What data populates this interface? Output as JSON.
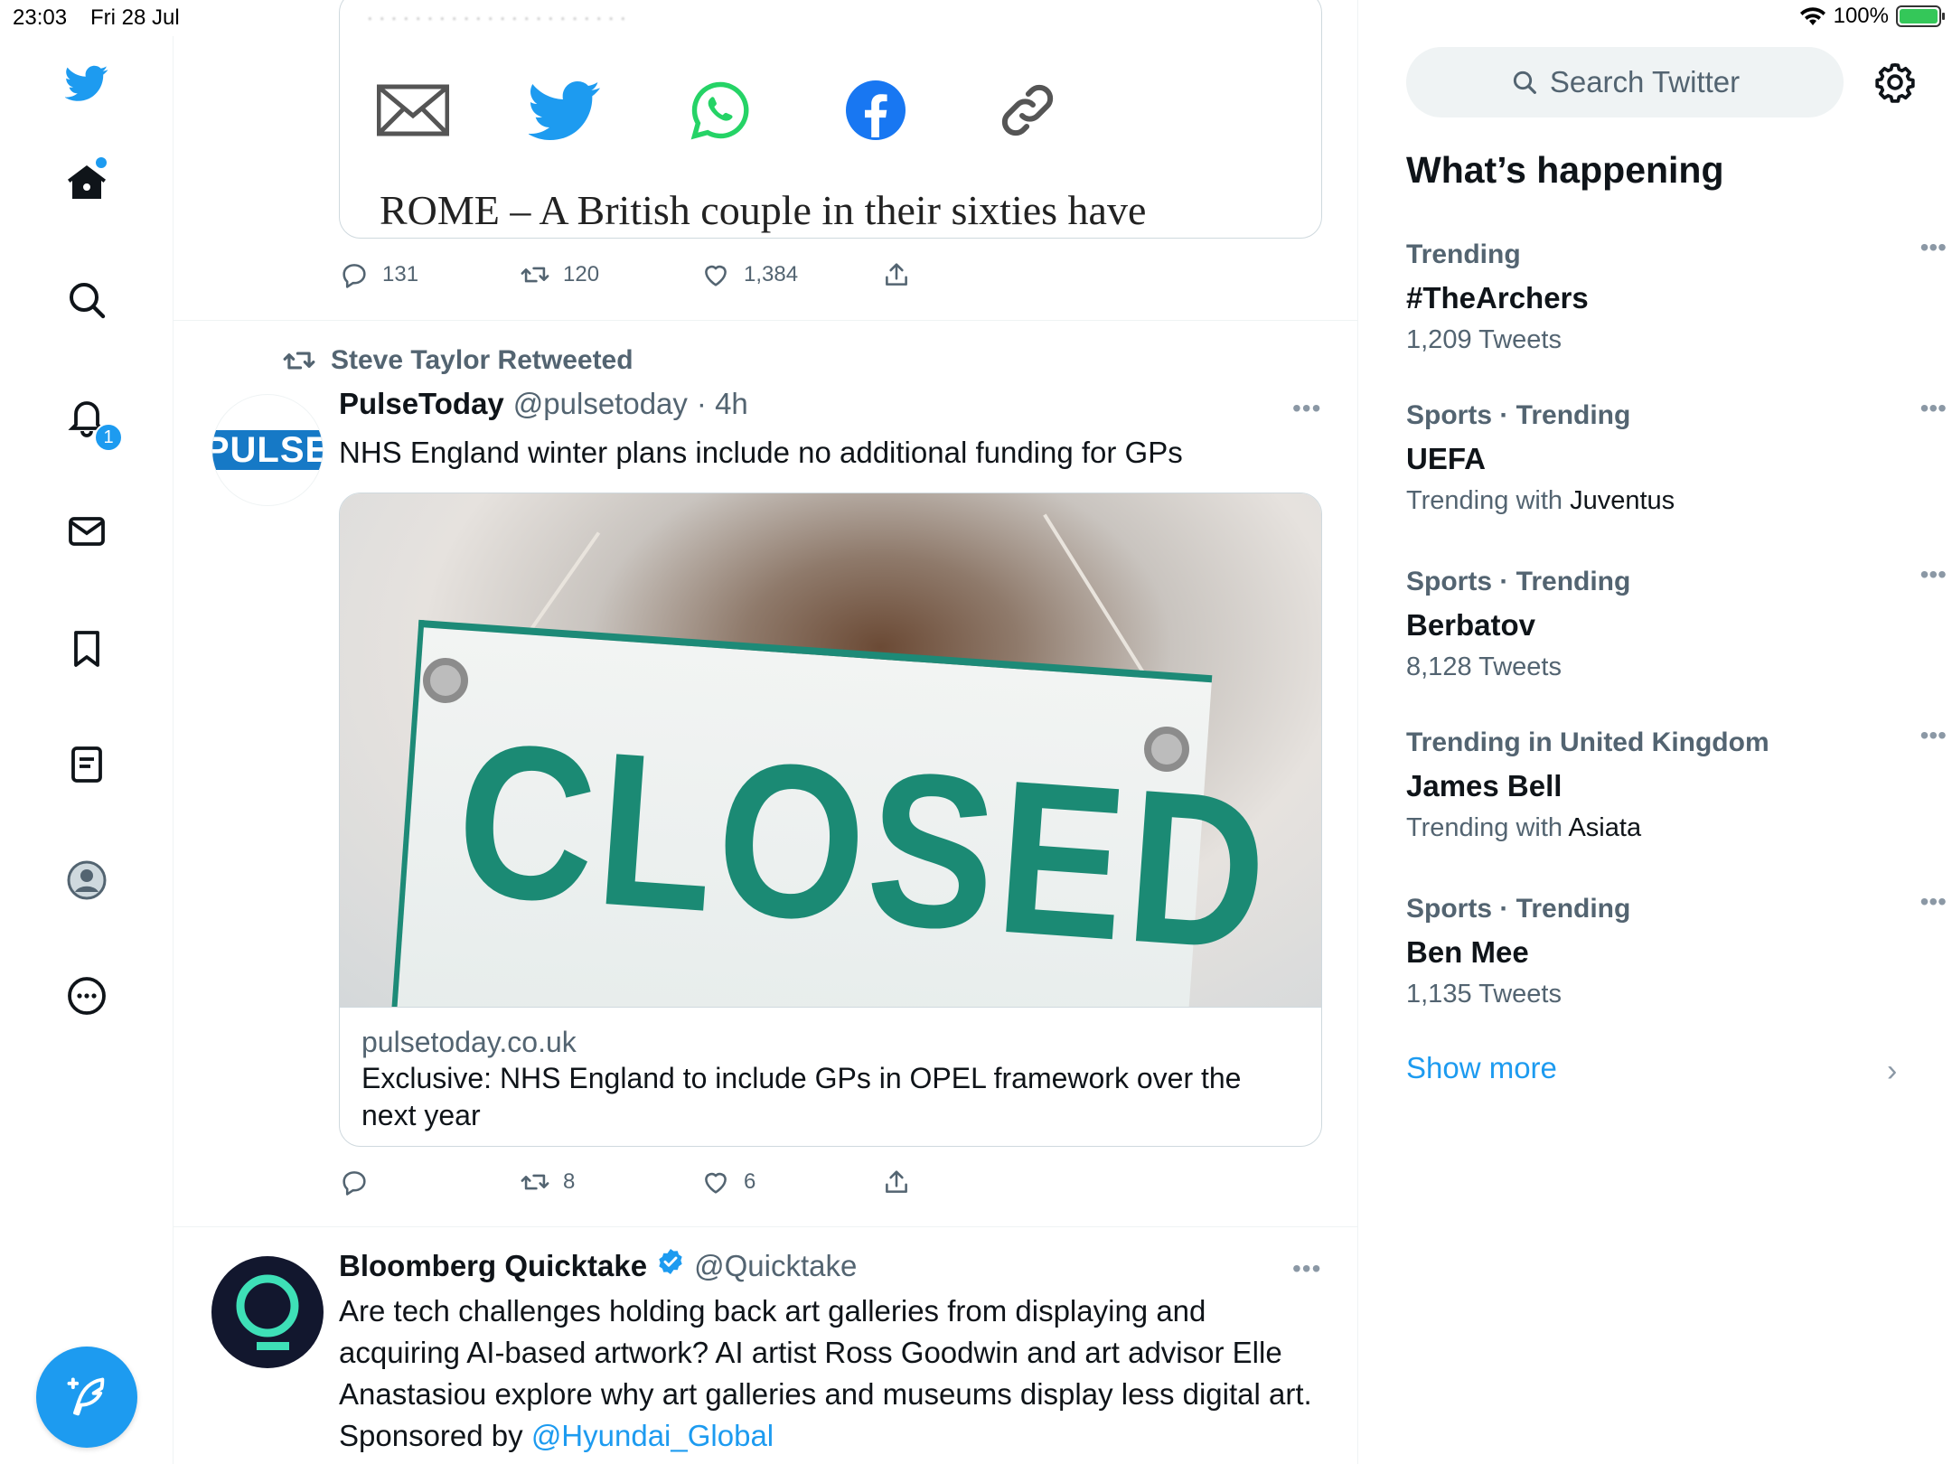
{
  "status_bar": {
    "time": "23:03",
    "date": "Fri 28 Jul",
    "battery": "100%",
    "handle_dots": "•••"
  },
  "nav": {
    "notification_count": "1",
    "icons": [
      "twitter-bird-icon",
      "home-icon",
      "search-icon",
      "bell-icon",
      "mail-icon",
      "bookmark-icon",
      "lists-icon",
      "profile-icon",
      "more-icon"
    ]
  },
  "tweet_top": {
    "article_snippet": "ROME – A British couple in their sixties have",
    "replies": "131",
    "retweets": "120",
    "likes": "1,384"
  },
  "tweet_pulse": {
    "retweeted_by": "Steve Taylor Retweeted",
    "avatar_text": "PULSE",
    "name": "PulseToday",
    "handle": "@pulsetoday",
    "time": "· 4h",
    "text": "NHS England winter plans include no additional funding for GPs",
    "photo_text": "CLOSED",
    "link_domain": "pulsetoday.co.uk",
    "link_title": "Exclusive: NHS England to include GPs in OPEL framework over the next year",
    "replies": "",
    "retweets": "8",
    "likes": "6"
  },
  "tweet_bloomberg": {
    "name": "Bloomberg Quicktake",
    "handle": "@Quicktake",
    "text": "Are tech challenges holding back art galleries from displaying and acquiring AI-based artwork? AI artist Ross Goodwin and art advisor Elle Anastasiou explore why art galleries and museums display less digital art. Sponsored by ",
    "mention": "@Hyundai_Global"
  },
  "sidebar": {
    "search_placeholder": "Search Twitter",
    "title": "What’s happening",
    "trends": [
      {
        "meta": "Trending",
        "topic": "#TheArchers",
        "sub": "1,209 Tweets",
        "sub_bold": ""
      },
      {
        "meta": "Sports · Trending",
        "topic": "UEFA",
        "sub": "Trending with ",
        "sub_bold": "Juventus"
      },
      {
        "meta": "Sports · Trending",
        "topic": "Berbatov",
        "sub": "8,128 Tweets",
        "sub_bold": ""
      },
      {
        "meta": "Trending in United Kingdom",
        "topic": "James Bell",
        "sub": "Trending with ",
        "sub_bold": "Asiata"
      },
      {
        "meta": "Sports · Trending",
        "topic": "Ben Mee",
        "sub": "1,135 Tweets",
        "sub_bold": ""
      }
    ],
    "show_more": "Show more"
  },
  "colors": {
    "accent": "#1d9bf0",
    "text_primary": "#0f1419",
    "text_secondary": "#536471",
    "border": "#cfd9de"
  }
}
